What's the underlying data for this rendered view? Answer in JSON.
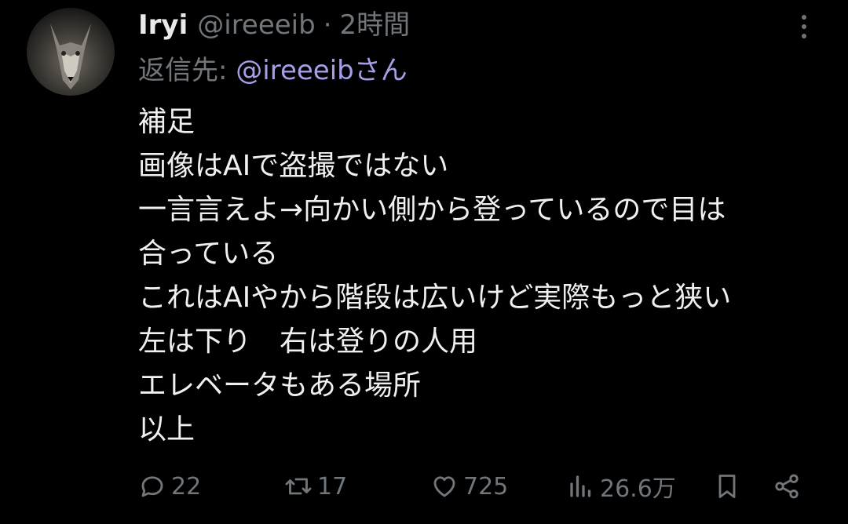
{
  "tweet": {
    "display_name": "Iryi",
    "handle": "@ireeeib",
    "separator": "·",
    "time": "2時間",
    "reply_prefix": "返信先: ",
    "reply_mention": "@ireeeibさん",
    "lines": [
      "補足",
      "画像はAIで盗撮ではない",
      "一言言えよ→向かい側から登っているので目は",
      "合っている",
      "これはAIやから階段は広いけど実際もっと狭い",
      "左は下り　右は登りの人用",
      "エレベータもある場所",
      "以上"
    ]
  },
  "actions": {
    "reply_count": "22",
    "retweet_count": "17",
    "like_count": "725",
    "views_count": "26.6万"
  },
  "icons": {
    "avatar": "wolf-avatar",
    "more": "more-vertical-icon",
    "reply": "reply-icon",
    "retweet": "retweet-icon",
    "like": "heart-icon",
    "views": "views-icon",
    "bookmark": "bookmark-icon",
    "share": "share-icon"
  }
}
